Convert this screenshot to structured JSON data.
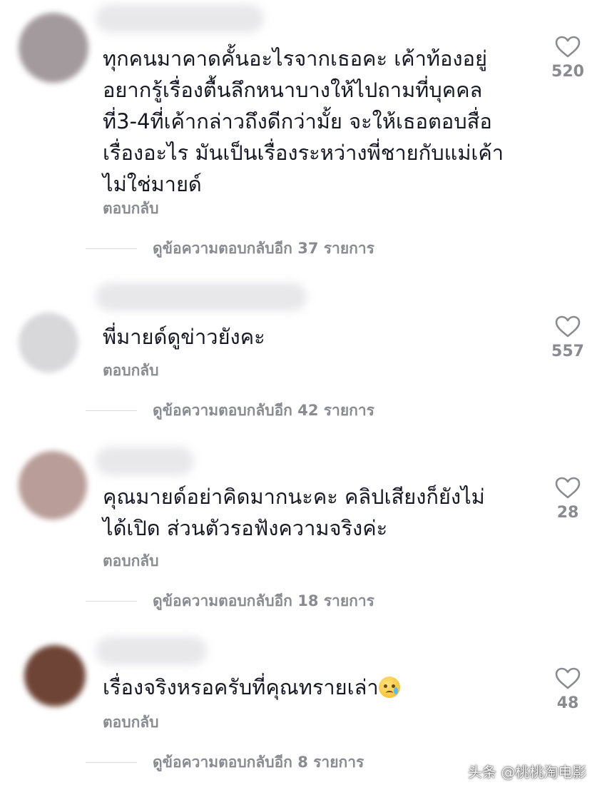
{
  "comments": [
    {
      "avatar_color": "#a39a9d",
      "text": "ทุกคนมาคาดคั้นอะไรจากเธอคะ เค้าท้องอยู่\nอยากรู้เรื่องตื้นลึกหนาบางให้ไปถามที่บุคคล\nที่3-4ที่เค้ากล่าวถึงดีกว่ามั้ย จะให้เธอตอบสื่อ\nเรื่องอะไร มันเป็นเรื่องระหว่างพี่ชายกับแม่เค้า\nไม่ใช่มายด์",
      "reply": "ตอบกลับ",
      "view_replies": "ดูข้อความตอบกลับอีก 37 รายการ",
      "likes": "520",
      "like_icon": "heart-outline-icon"
    },
    {
      "avatar_color": "#d8d8da",
      "text": "พี่มายด์ดูข่าวยังคะ",
      "reply": "ตอบกลับ",
      "view_replies": "ดูข้อความตอบกลับอีก 42 รายการ",
      "likes": "557",
      "like_icon": "heart-outline-icon"
    },
    {
      "avatar_color": "#b89d98",
      "text": "คุณมายด์อย่าคิดมากนะคะ คลิปเสียงก็ยังไม่\nได้เปิด ส่วนตัวรอฟังความจริงค่ะ",
      "reply": "ตอบกลับ",
      "view_replies": "ดูข้อความตอบกลับอีก 18 รายการ",
      "likes": "28",
      "like_icon": "heart-outline-icon"
    },
    {
      "avatar_color": "#6e4436",
      "text": "เรื่องจริงหรอครับที่คุณทรายเล่า",
      "emoji": "crying-face-emoji",
      "reply": "ตอบกลับ",
      "view_replies": "ดูข้อความตอบกลับอีก 8 รายการ",
      "likes": "48",
      "like_icon": "heart-outline-icon"
    }
  ],
  "watermark": "头条 @桃桃淘电影",
  "colors": {
    "text_primary": "#161823",
    "text_secondary": "#8a8b91",
    "divider": "#d9d9dc"
  }
}
